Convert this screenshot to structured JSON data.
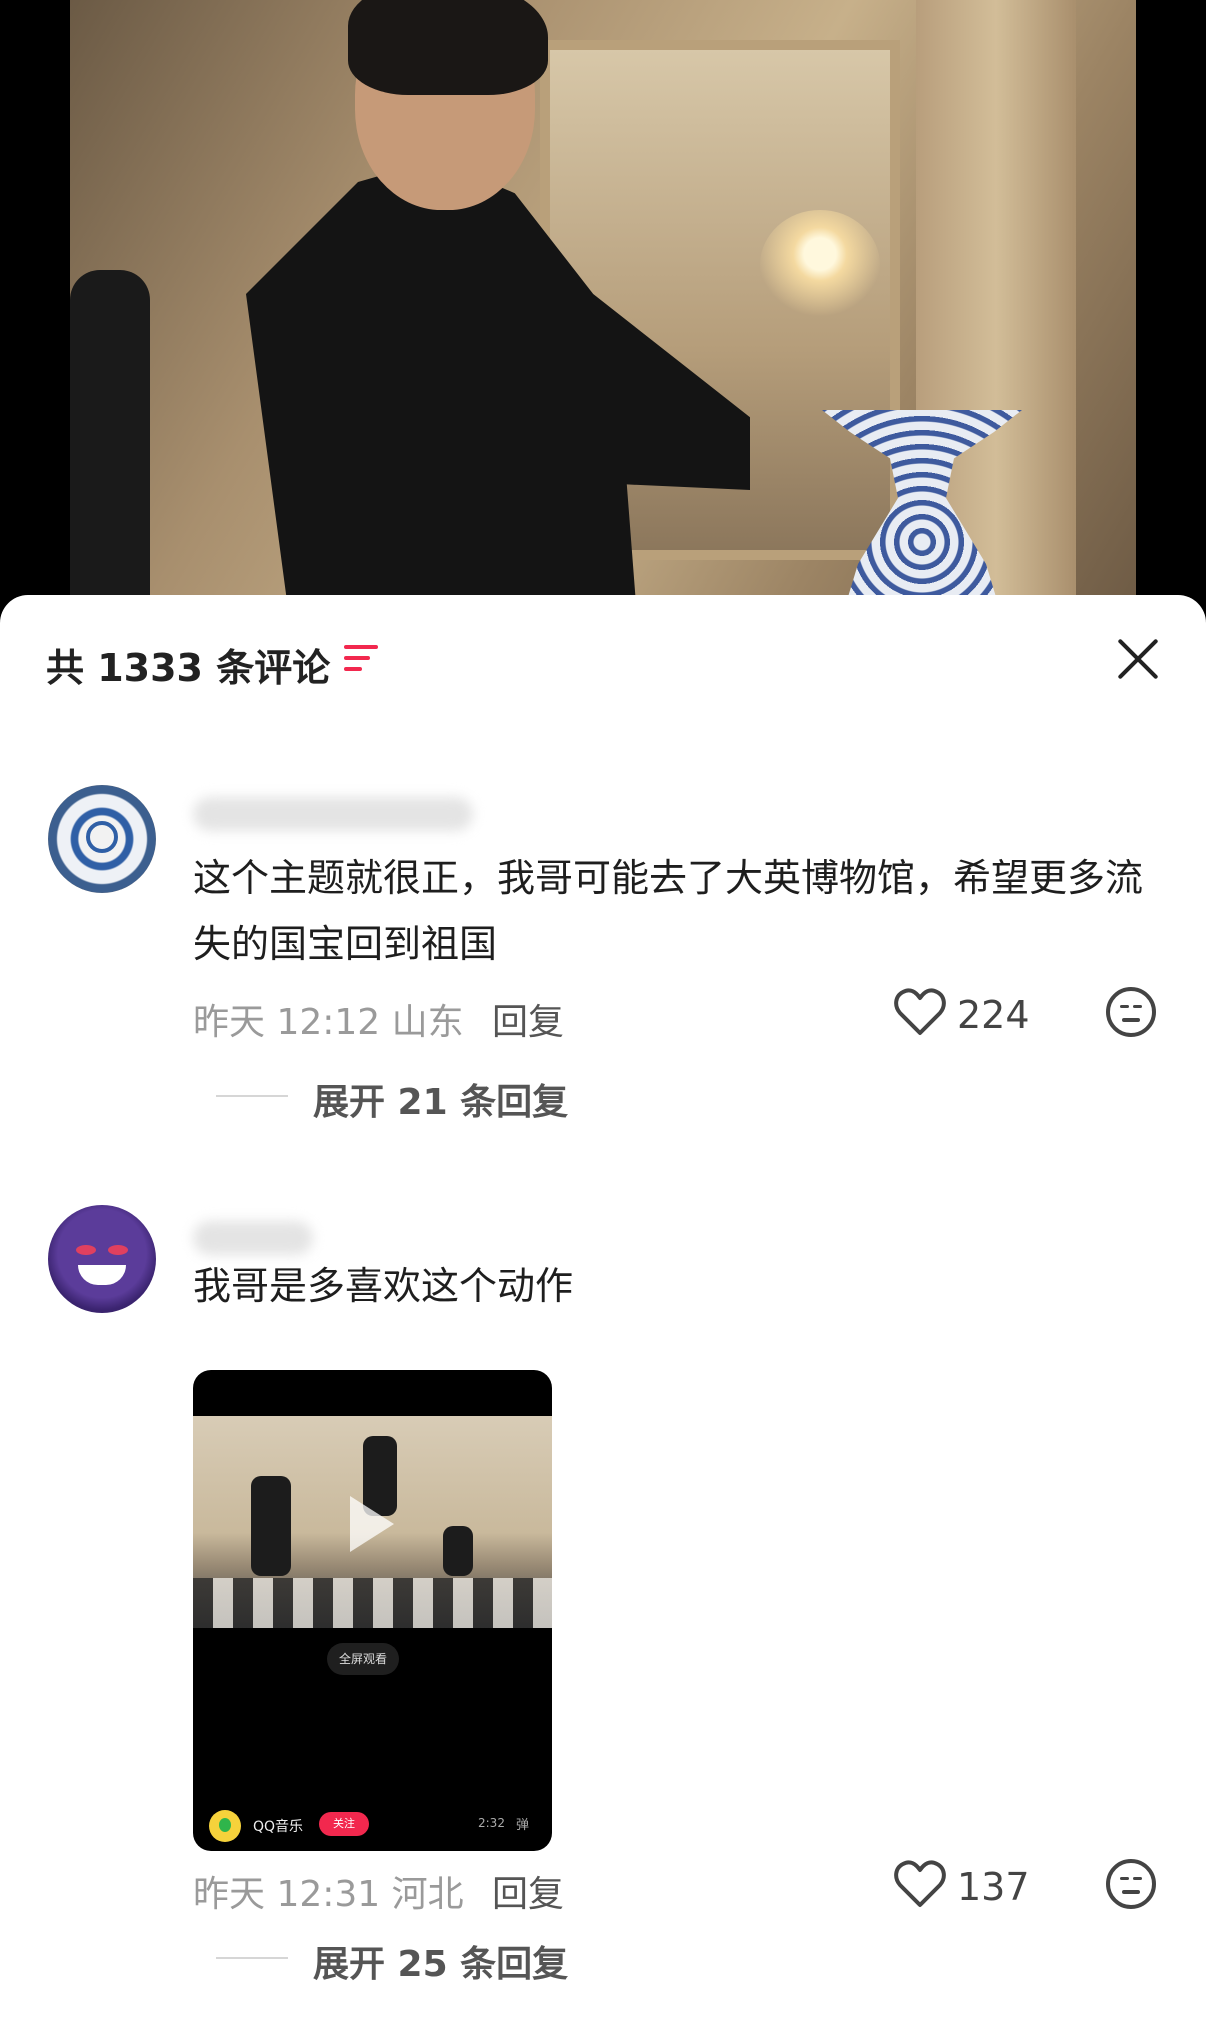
{
  "header": {
    "count_title": "共 1333 条评论"
  },
  "comments": [
    {
      "text": "这个主题就很正，我哥可能去了大英博物馆，希望更多流失的国宝回到祖国",
      "time_location": "昨天 12:12 山东",
      "reply_label": "回复",
      "likes": "224",
      "expand_label": "展开 21 条回复"
    },
    {
      "text": "我哥是多喜欢这个动作",
      "time_location": "昨天 12:31 河北",
      "reply_label": "回复",
      "likes": "137",
      "expand_label": "展开 25 条回复",
      "video": {
        "fullscreen_label": "全屏观看",
        "brand": "QQ音乐",
        "follow_label": "关注",
        "duration": "2:32",
        "danmu_label": "弹"
      }
    }
  ],
  "colors": {
    "accent": "#f2284e",
    "text_primary": "#1e1e1e",
    "text_secondary": "#9a9a9a"
  },
  "icons": [
    "sort-icon",
    "close-icon",
    "heart-icon",
    "emoji-icon",
    "play-icon",
    "qq-music-icon"
  ]
}
